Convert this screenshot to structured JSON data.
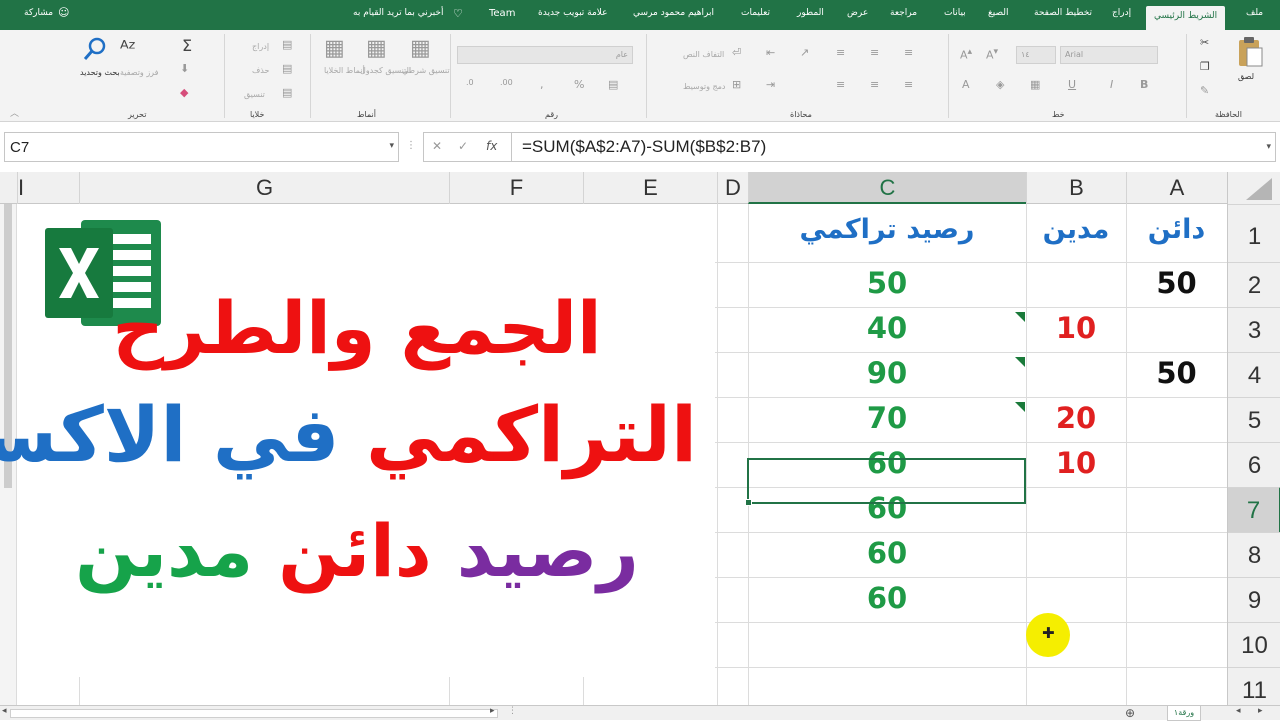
{
  "app": {
    "tabs": [
      {
        "label": "ملف"
      },
      {
        "label": "الشريط الرئيسي"
      },
      {
        "label": "إدراج"
      },
      {
        "label": "تخطيط الصفحة"
      },
      {
        "label": "الصيغ"
      },
      {
        "label": "بيانات"
      },
      {
        "label": "مراجعة"
      },
      {
        "label": "عرض"
      },
      {
        "label": "المطور"
      },
      {
        "label": "تعليمات"
      },
      {
        "label": "ابراهيم محمود مرسي"
      },
      {
        "label": "علامة تبويب جديدة"
      },
      {
        "label": "Team"
      }
    ],
    "tell_me": "أخبرني بما تريد القيام به",
    "share": "مشاركة",
    "accent_color": "#217346"
  },
  "ribbon": {
    "clipboard": {
      "paste": "لصق",
      "group": "الحافظة"
    },
    "font": {
      "name": "Arial",
      "size": "١٤",
      "group": "خط"
    },
    "alignment": {
      "wrap": "التفاف النص",
      "merge": "دمج وتوسيط",
      "group": "محاذاة"
    },
    "number": {
      "format": "عام",
      "group": "رقم"
    },
    "styles": {
      "conditional": "تنسيق شرطي",
      "as_table": "التنسيق كجدول",
      "cell_styles": "أنماط الخلايا",
      "group": "أنماط"
    },
    "cells": {
      "insert": "إدراج",
      "delete": "حذف",
      "format": "تنسيق",
      "group": "خلايا"
    },
    "editing": {
      "sort": "فرز وتصفية",
      "find": "بحث وتحديد",
      "group": "تحرير"
    }
  },
  "formula_bar": {
    "name_box": "C7",
    "formula": "=SUM($A$2:A7)-SUM($B$2:B7)"
  },
  "sheet": {
    "columns": [
      "A",
      "B",
      "C",
      "D",
      "E",
      "F",
      "G",
      "I"
    ],
    "rows": [
      "1",
      "2",
      "3",
      "4",
      "5",
      "6",
      "7",
      "8",
      "9",
      "10",
      "11"
    ],
    "headers": {
      "A": "دائن",
      "B": "مدين",
      "C": "رصيد تراكمي"
    },
    "col_a": [
      "50",
      "",
      "50",
      "",
      "",
      "",
      "",
      ""
    ],
    "col_b": [
      "",
      "10",
      "",
      "20",
      "10",
      "",
      "",
      ""
    ],
    "col_c": [
      "50",
      "40",
      "90",
      "70",
      "60",
      "60",
      "60",
      "60"
    ],
    "selected_cell": "C7",
    "sheet_tab": "ورقة١"
  },
  "overlay": {
    "line1": "الجمع والطرح",
    "line2_a": "التراكمي",
    "line2_b": "في",
    "line2_c": "الاكسل",
    "line3_a": "رصيد",
    "line3_b": "دائن",
    "line3_c": "مدين"
  }
}
